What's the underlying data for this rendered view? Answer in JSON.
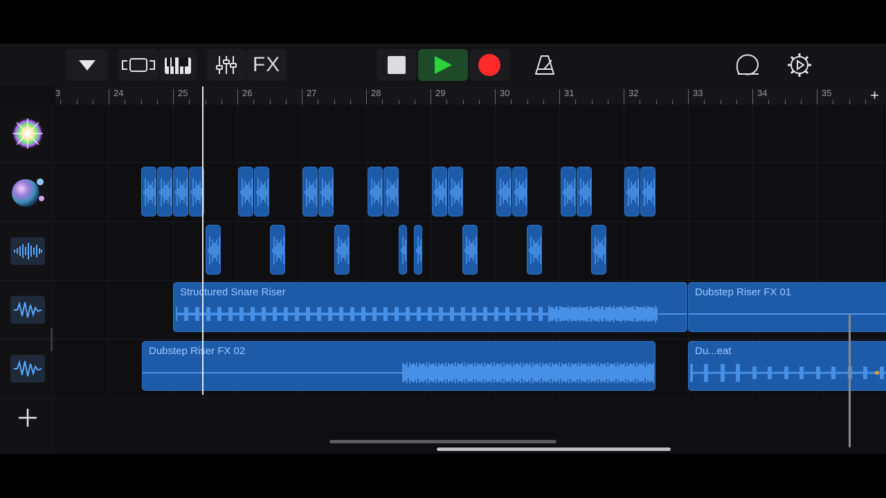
{
  "toolbar": {
    "fx_label": "FX",
    "buttons": [
      "browser-dropdown",
      "tracks-view",
      "instrument-keyboard",
      "mixer",
      "fx",
      "stop",
      "play",
      "record",
      "metronome",
      "loop-browser",
      "settings"
    ]
  },
  "colors": {
    "accent_play": "#2ed23b",
    "record_red": "#ff2a2a",
    "region_blue": "#1d5aa8",
    "waveform_blue": "#5aa8ff"
  },
  "ruler": {
    "bars": [
      "3",
      "24",
      "25",
      "26",
      "27",
      "28",
      "29",
      "30",
      "31",
      "32",
      "33",
      "34",
      "35"
    ],
    "add_label": "+"
  },
  "tracks": [
    {
      "name": "track-1",
      "icon": "sparkle-icon"
    },
    {
      "name": "track-2",
      "icon": "orb-icon"
    },
    {
      "name": "track-3",
      "icon": "audio-waveform-icon"
    },
    {
      "name": "track-4",
      "icon": "waveform-icon"
    },
    {
      "name": "track-5",
      "icon": "waveform-icon"
    }
  ],
  "regions": {
    "structured_snare_riser": "Structured Snare Riser",
    "dubstep_riser_fx_01": "Dubstep Riser FX 01",
    "dubstep_riser_fx_02": "Dubstep Riser FX 02",
    "du_eat": "Du...eat"
  },
  "add_track_label": "+"
}
